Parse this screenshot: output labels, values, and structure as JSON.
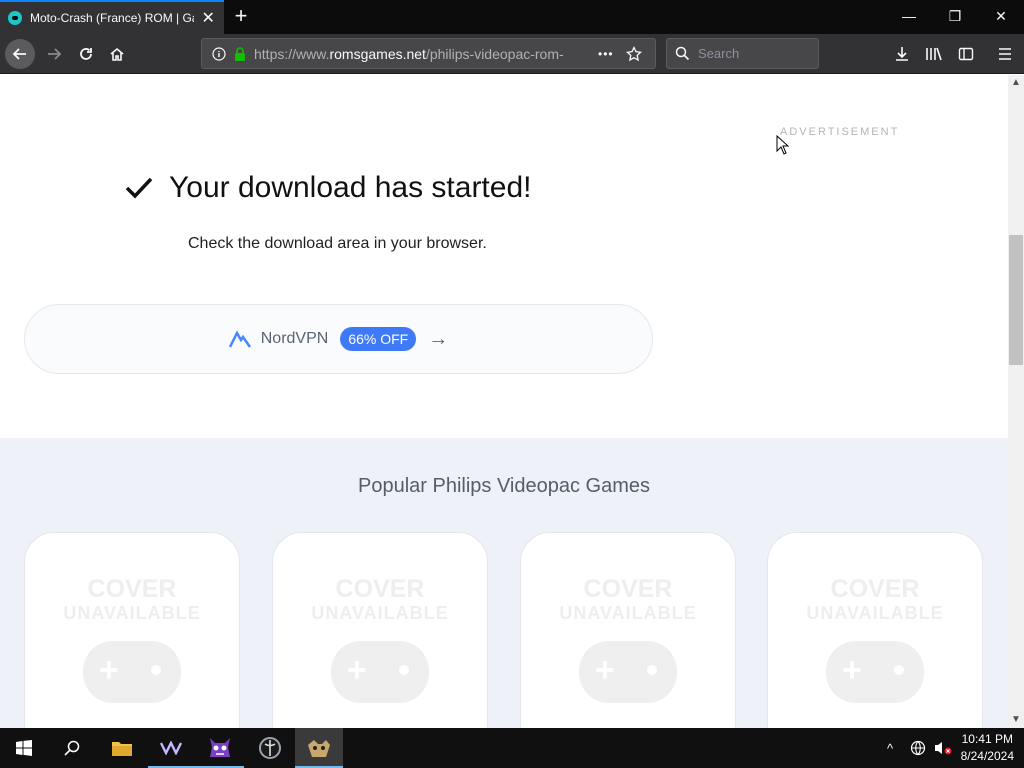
{
  "browser": {
    "tab_title": "Moto-Crash (France) ROM | Games",
    "tab_close": "✕",
    "new_tab": "+",
    "url_prefix": "https://www.",
    "url_host": "romsgames.net",
    "url_path": "/philips-videopac-rom-",
    "page_actions": "•••",
    "search_placeholder": "Search",
    "window_minimize": "—",
    "window_restore": "❐",
    "window_close": "✕"
  },
  "page": {
    "ad_label": "ADVERTISEMENT",
    "download_title": "Your download has started!",
    "download_subtitle": "Check the download area in your browser.",
    "vpn": {
      "name": "NordVPN",
      "badge": "66% OFF",
      "arrow": "→"
    },
    "popular_title": "Popular Philips Videopac Games",
    "cards": [
      {
        "cover_line1": "COVER",
        "cover_line2": "UNAVAILABLE"
      },
      {
        "cover_line1": "COVER",
        "cover_line2": "UNAVAILABLE"
      },
      {
        "cover_line1": "COVER",
        "cover_line2": "UNAVAILABLE"
      },
      {
        "cover_line1": "COVER",
        "cover_line2": "UNAVAILABLE"
      }
    ]
  },
  "taskbar": {
    "time": "10:41 PM",
    "date": "8/24/2024",
    "tray_chevron": "^"
  },
  "colors": {
    "accent": "#0a84ff",
    "badge": "#3e79f7",
    "site_teal": "#1ec7c7"
  }
}
